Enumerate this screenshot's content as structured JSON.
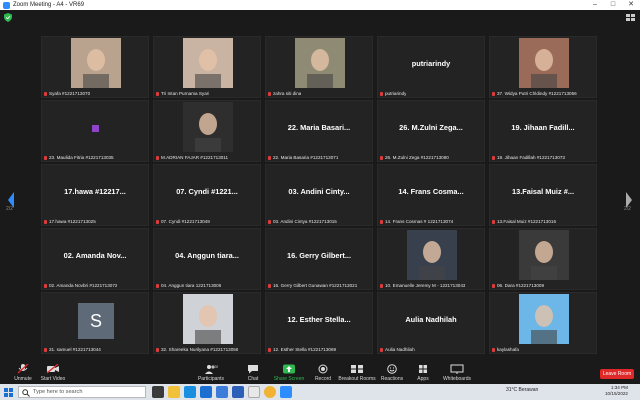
{
  "window": {
    "title": "Zoom Meeting - A4 - VR69"
  },
  "nav": {
    "left_page": "2/2",
    "right_page": "2/2"
  },
  "tiles": [
    {
      "label": "Syafa #1221713070",
      "big": "",
      "photo": "#b9a38e"
    },
    {
      "label": "Tri Intan Purnama Syari",
      "big": "",
      "photo": "#c9b3a3"
    },
    {
      "label": "zahra siti dina",
      "big": "",
      "photo": "#8e8a74"
    },
    {
      "label": "putriarindy",
      "big": "putriarindy",
      "photo": ""
    },
    {
      "label": "37. Widya Putri Chldindy #1221713056",
      "big": "",
      "photo": "#9a6b58"
    },
    {
      "label": "23. Maulida Fitria #1221713035",
      "big": "",
      "photo": ""
    },
    {
      "label": "M.ADRIAN FAJAR #1221713011",
      "big": "",
      "photo": "#2e2e2e"
    },
    {
      "label": "22. Maria Basaria #1221713071",
      "big": "22. Maria Basari...",
      "photo": ""
    },
    {
      "label": "26. M.Zulni Zega #1221713080",
      "big": "26. M.Zulni Zega...",
      "photo": ""
    },
    {
      "label": "19. Jihaan Fadillah #1221713073",
      "big": "19. Jihaan Fadill...",
      "photo": ""
    },
    {
      "label": "17.hawa #1221713025",
      "big": "17.hawa #12217...",
      "photo": ""
    },
    {
      "label": "07. Cyndi #1221713049",
      "big": "07. Cyndi #1221...",
      "photo": ""
    },
    {
      "label": "03. Andini Cintya #1221713015",
      "big": "03. Andini Cinty...",
      "photo": ""
    },
    {
      "label": "14. Frans Cosmas # 1221713074",
      "big": "14. Frans Cosma...",
      "photo": ""
    },
    {
      "label": "13.Faisal Muiz #1221713016",
      "big": "13.Faisal Muiz #...",
      "photo": ""
    },
    {
      "label": "02. Amanda Novbri #1221713072",
      "big": "02. Amanda Nov...",
      "photo": ""
    },
    {
      "label": "04. Anggun tiara 1221713006",
      "big": "04. Anggun tiara...",
      "photo": ""
    },
    {
      "label": "16. Gerry Gilbert Gunawan #1221713021",
      "big": "16. Gerry Gilbert...",
      "photo": ""
    },
    {
      "label": "10. Emanuelle Jeremy M - 1221713043",
      "big": "",
      "photo": "#38404e"
    },
    {
      "label": "06. Dara #1221713009",
      "big": "",
      "photo": "#3a3a3a"
    },
    {
      "label": "31. samuel #1221713044",
      "big": "",
      "photo": ""
    },
    {
      "label": "32. Shareeka Nurilyana #1221713056",
      "big": "",
      "photo": "#cfd3d8"
    },
    {
      "label": "12. Esther Stella #1221713069",
      "big": "12. Esther Stella...",
      "photo": ""
    },
    {
      "label": "Aulia Nadhilah",
      "big": "Aulia Nadhilah",
      "photo": ""
    },
    {
      "label": "kaylashafa",
      "big": "",
      "photo": "#6cb7e8"
    }
  ],
  "avatar_letter": "S",
  "toolbar": {
    "unmute": "Unmute",
    "start_video": "Start Video",
    "participants": "Participants",
    "participants_count": "39",
    "chat": "Chat",
    "share_screen": "Share Screen",
    "record": "Record",
    "breakout": "Breakout Rooms",
    "reactions": "Reactions",
    "apps": "Apps",
    "whiteboards": "Whiteboards",
    "leave": "Leave Room"
  },
  "taskbar": {
    "search_placeholder": "Type here to search",
    "weather": "31°C  Berawan",
    "time": "1:34 PM",
    "date": "10/15/2022"
  },
  "colors": {
    "accent": "#2d8cff",
    "leave": "#e02828",
    "share": "#2fb84f"
  }
}
